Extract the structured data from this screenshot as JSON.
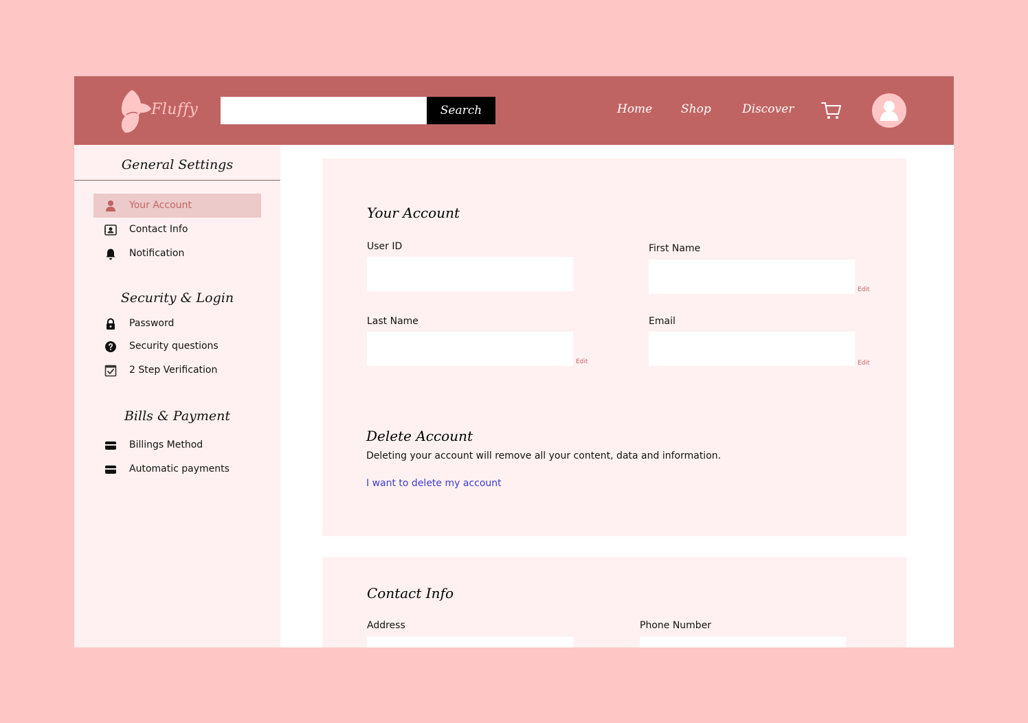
{
  "brand": {
    "name": "Fluffy"
  },
  "header": {
    "search_placeholder": "",
    "search_value": "",
    "search_button": "Search",
    "nav": [
      "Home",
      "Shop",
      "Discover"
    ],
    "cart_icon": "cart-icon",
    "avatar_icon": "user-avatar-icon"
  },
  "sidebar": {
    "groups": [
      {
        "title": "General Settings",
        "items": [
          {
            "label": "Your Account",
            "icon": "user-icon",
            "active": true
          },
          {
            "label": "Contact Info",
            "icon": "contact-card-icon"
          },
          {
            "label": "Notification",
            "icon": "bell-icon"
          }
        ]
      },
      {
        "title": "Security & Login",
        "items": [
          {
            "label": "Password",
            "icon": "lock-icon"
          },
          {
            "label": "Security questions",
            "icon": "question-icon"
          },
          {
            "label": "2 Step Verification",
            "icon": "checkbox-icon"
          }
        ]
      },
      {
        "title": "Bills & Payment",
        "items": [
          {
            "label": "Billings Method",
            "icon": "credit-card-icon"
          },
          {
            "label": "Automatic payments",
            "icon": "credit-card-icon"
          }
        ]
      }
    ]
  },
  "account": {
    "title": "Your Account",
    "user_id_label": "User ID",
    "user_id_value": "",
    "first_name_label": "First Name",
    "first_name_value": "",
    "last_name_label": "Last Name",
    "last_name_value": "",
    "email_label": "Email",
    "email_value": "",
    "edit_label": "Edit"
  },
  "delete": {
    "title": "Delete Account",
    "description": "Deleting your account will remove all your content, data and information.",
    "link": "I want to delete my account"
  },
  "contact": {
    "title": "Contact Info",
    "address_label": "Address",
    "address_value": "",
    "phone_label": "Phone Number",
    "phone_value": ""
  },
  "colors": {
    "page_background": "#ffc6c6",
    "header": "#c06463",
    "panel": "#fff1f1",
    "active_item": "#eccaca",
    "link": "#3c3ccb"
  }
}
